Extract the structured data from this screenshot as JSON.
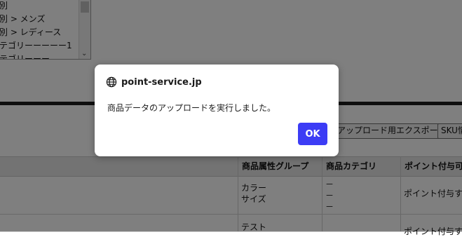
{
  "category_list": {
    "options": [
      "別",
      "別 > メンズ",
      "別 > レディース",
      "テゴリーーーーー1",
      "テゴリーーー"
    ]
  },
  "toolbar": {
    "export_label": "アップロード用エクスポート",
    "sku_label": "SKU情"
  },
  "table": {
    "columns": [
      "商品属性グループ",
      "商品カテゴリ",
      "ポイント付与可否"
    ],
    "rows": [
      {
        "attr_group": [
          "カラー",
          "サイズ"
        ],
        "category": [
          "－",
          "－",
          "－"
        ],
        "point": "ポイント付与する"
      },
      {
        "attr_group": [
          "テスト"
        ],
        "category": [],
        "point": "ポイント付与する"
      }
    ]
  },
  "dialog": {
    "host": "point-service.jp",
    "icon": "globe-icon",
    "message": "商品データのアップロードを実行しました。",
    "ok_label": "OK",
    "accent_color": "#3c3cf5"
  }
}
